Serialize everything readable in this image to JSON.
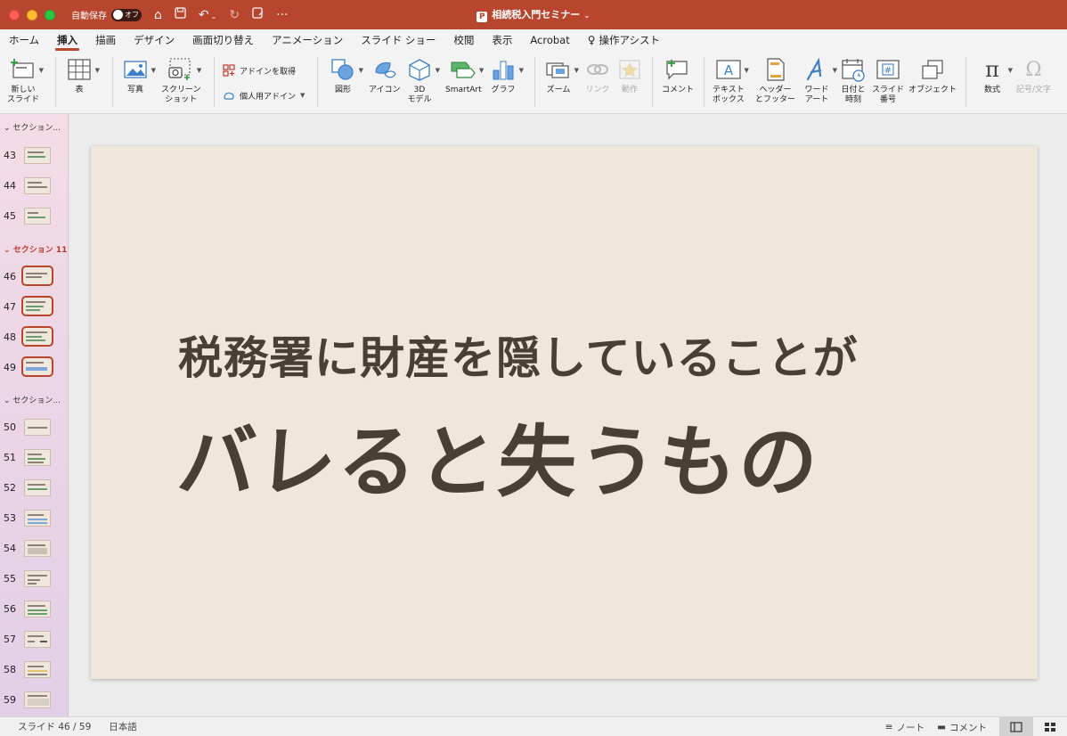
{
  "titlebar": {
    "autosave_label": "自動保存",
    "autosave_state": "オフ",
    "doc_title": "相続税入門セミナー",
    "doc_title_suffix": "⌄",
    "accent_color": "#b8452d"
  },
  "tabs": [
    {
      "label": "ホーム"
    },
    {
      "label": "挿入",
      "active": true
    },
    {
      "label": "描画"
    },
    {
      "label": "デザイン"
    },
    {
      "label": "画面切り替え"
    },
    {
      "label": "アニメーション"
    },
    {
      "label": "スライド ショー"
    },
    {
      "label": "校閲"
    },
    {
      "label": "表示"
    },
    {
      "label": "Acrobat"
    },
    {
      "label": "操作アシスト"
    }
  ],
  "ribbon": {
    "new_slide": "新しい\nスライド",
    "table": "表",
    "picture": "写真",
    "screenshot": "スクリーン\nショット",
    "get_addins": "アドインを取得",
    "my_addins": "個人用アドイン",
    "shapes": "図形",
    "icons": "アイコン",
    "model3d": "3D\nモデル",
    "smartart": "SmartArt",
    "chart": "グラフ",
    "zoom": "ズーム",
    "link": "リンク",
    "action": "動作",
    "comment": "コメント",
    "textbox": "テキスト\nボックス",
    "header_footer": "ヘッダー\nとフッター",
    "wordart": "ワード\nアート",
    "datetime": "日付と\n時刻",
    "slide_number": "スライド\n番号",
    "object": "オブジェクト",
    "equation": "数式",
    "symbol": "記号/文字"
  },
  "sidebar": {
    "sections": [
      {
        "label": "セクション...",
        "highlighted": false
      },
      {
        "label": "セクション 11",
        "highlighted": true
      },
      {
        "label": "セクション...",
        "highlighted": false
      }
    ],
    "slides": [
      {
        "num": "43",
        "selected": false
      },
      {
        "num": "44",
        "selected": false
      },
      {
        "num": "45",
        "selected": false
      },
      {
        "num": "46",
        "selected": true
      },
      {
        "num": "47",
        "selected": true
      },
      {
        "num": "48",
        "selected": true
      },
      {
        "num": "49",
        "selected": true
      },
      {
        "num": "50",
        "selected": false
      },
      {
        "num": "51",
        "selected": false
      },
      {
        "num": "52",
        "selected": false
      },
      {
        "num": "53",
        "selected": false
      },
      {
        "num": "54",
        "selected": false
      },
      {
        "num": "55",
        "selected": false
      },
      {
        "num": "56",
        "selected": false
      },
      {
        "num": "57",
        "selected": false
      },
      {
        "num": "58",
        "selected": false
      },
      {
        "num": "59",
        "selected": false
      }
    ]
  },
  "slide": {
    "line1": "税務署に財産を隠していることが",
    "line2": "バレると失うもの",
    "bg_color": "#efe6dc",
    "text_color": "#4a3f35"
  },
  "status": {
    "slide_indicator": "スライド 46 / 59",
    "language": "日本語",
    "notes": "ノート",
    "comments": "コメント"
  }
}
